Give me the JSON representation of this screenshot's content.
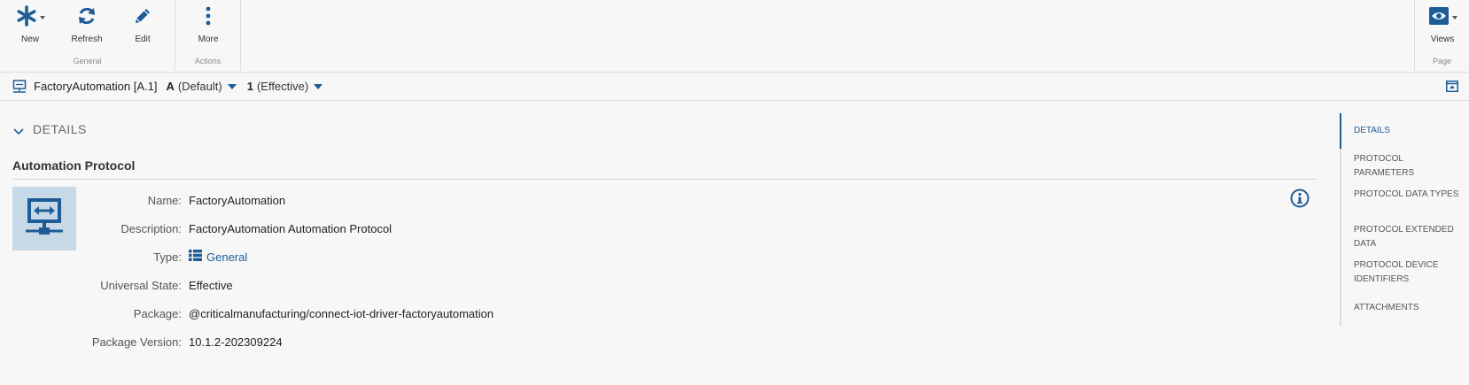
{
  "ribbon": {
    "groups": {
      "general": "General",
      "actions": "Actions",
      "page": "Page"
    },
    "buttons": {
      "new": "New",
      "refresh": "Refresh",
      "edit": "Edit",
      "more": "More",
      "views": "Views"
    }
  },
  "breadcrumb": {
    "entity": "FactoryAutomation [A.1]",
    "version_letter": "A",
    "version_label": "(Default)",
    "revision_number": "1",
    "revision_label": "(Effective)"
  },
  "section": {
    "title": "DETAILS",
    "subtitle": "Automation Protocol"
  },
  "properties": [
    {
      "label": "Name:",
      "value": "FactoryAutomation"
    },
    {
      "label": "Description:",
      "value": "FactoryAutomation Automation Protocol"
    },
    {
      "label": "Type:",
      "value": "General"
    },
    {
      "label": "Universal State:",
      "value": "Effective"
    },
    {
      "label": "Package:",
      "value": "@criticalmanufacturing/connect-iot-driver-factoryautomation"
    },
    {
      "label": "Package Version:",
      "value": "10.1.2-202309224"
    }
  ],
  "right_nav": [
    {
      "label": "DETAILS",
      "active": true
    },
    {
      "label": "PROTOCOL PARAMETERS"
    },
    {
      "label": "PROTOCOL DATA TYPES"
    },
    {
      "label": "PROTOCOL EXTENDED DATA"
    },
    {
      "label": "PROTOCOL DEVICE IDENTIFIERS"
    },
    {
      "label": "ATTACHMENTS"
    }
  ],
  "colors": {
    "accent": "#1e5c97",
    "tile_bg": "#c7d9e6",
    "background": "#f7f7f7"
  },
  "icons": {
    "new": "asterisk-icon",
    "refresh": "refresh-icon",
    "edit": "pencil-icon",
    "more": "vertical-dots-icon",
    "views": "eye-icon",
    "entity": "automation-protocol-icon",
    "type": "list-icon",
    "info": "info-icon",
    "collapse": "chevron-down-icon",
    "expand": "expand-panel-icon"
  }
}
